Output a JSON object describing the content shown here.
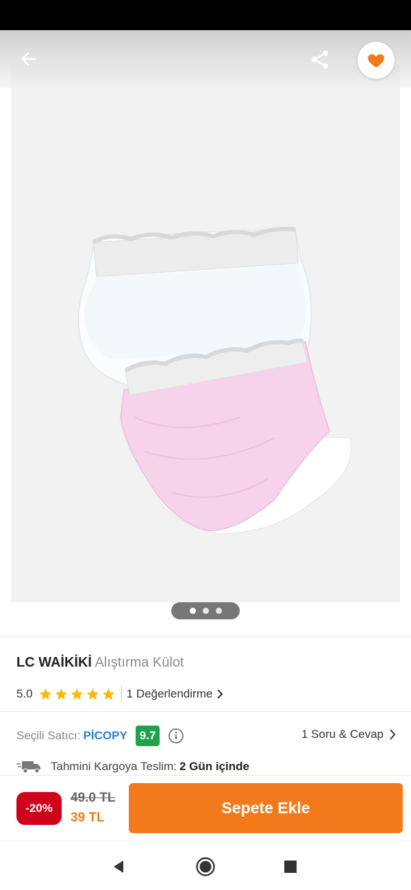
{
  "product": {
    "brand": "LC WAİKİKİ",
    "name": "Alıştırma Külot"
  },
  "rating": {
    "value": "5.0",
    "stars": 5,
    "review_label": "1 Değerlendirme"
  },
  "seller": {
    "label": "Seçili Satıcı:",
    "name": "PİCOPY",
    "score": "9.7"
  },
  "qa": {
    "label": "1 Soru & Cevap"
  },
  "shipping": {
    "label": "Tahmini Kargoya Teslim:",
    "value": "2 Gün içinde"
  },
  "pricing": {
    "discount": "-20%",
    "old_price": "49.0 TL",
    "new_price": "39 TL"
  },
  "cart": {
    "button_label": "Sepete Ekle"
  },
  "gallery": {
    "image_count": 3,
    "active_index": 0
  },
  "colors": {
    "accent": "#f27a1a",
    "discount": "#d0021b",
    "seller_link": "#2a7fd0",
    "score_badge": "#1fa34a",
    "star": "#f5b914"
  },
  "icons": [
    "back-arrow-icon",
    "share-icon",
    "heart-icon",
    "star-icon",
    "info-icon",
    "chevron-right-icon",
    "truck-icon",
    "nav-back-icon",
    "nav-home-icon",
    "nav-recents-icon"
  ]
}
